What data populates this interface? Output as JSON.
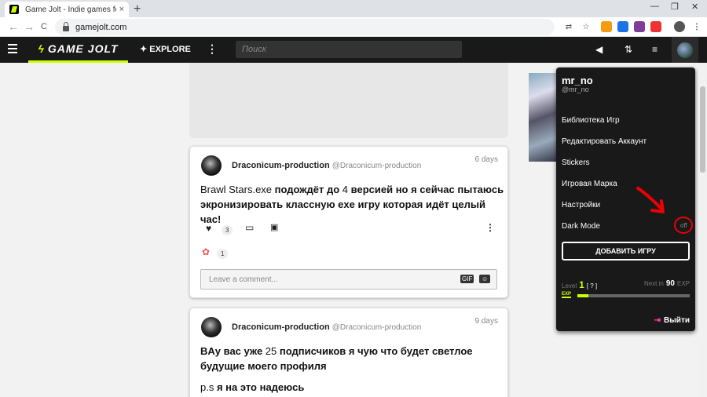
{
  "browser": {
    "tab_title": "Game Jolt - Indie games for the ...",
    "tab_close": "×",
    "new_tab": "+",
    "url": "gamejolt.com",
    "back": "←",
    "forward": "→",
    "reload": "C",
    "window_controls": [
      "—",
      "❐",
      "✕"
    ]
  },
  "navbar": {
    "logo": "GAME JOLT",
    "explore": "EXPLORE",
    "search_placeholder": "Поиск"
  },
  "posts": [
    {
      "author": "Draconicum-production",
      "handle": "@Draconicum-production",
      "time": "6 days",
      "body_line1_a": "Brawl Stars.exe",
      "body_line1_b": " подождёт до ",
      "body_line1_c": "4",
      "body_line1_d": " версией но я сейчас пытаюсь",
      "body_line2": "экронизировать классную exe игру которая идёт целый час!",
      "likes": "3",
      "reaction_count": "1",
      "comment_placeholder": "Leave a comment...",
      "gif_label": "GIF"
    },
    {
      "author": "Draconicum-production",
      "handle": "@Draconicum-production",
      "time": "9 days",
      "body_line1_a": "B",
      "body_line1_b": "Ау вас уже ",
      "body_line1_c": "25",
      "body_line1_d": " подписчиков я чую что будет светлое",
      "body_line2": "будущие моего профиля",
      "body_line3_a": "p.s",
      "body_line3_b": " я на это надеюсь"
    }
  ],
  "dropdown": {
    "username": "mr_no",
    "handle": "@mr_no",
    "items": [
      "Библиотека Игр",
      "Редактировать Аккаунт",
      "Stickers",
      "Игровая Марка",
      "Настройки",
      "Dark Mode"
    ],
    "dark_mode_state": "off",
    "add_game": "ДОБАВИТЬ ИГРУ",
    "level_label": "Level",
    "level": "1",
    "level_help": "[ ? ]",
    "next_label": "Next in",
    "next_value": "90",
    "next_unit": "EXP",
    "exp_label": "EXP",
    "exp_progress": 0.1,
    "logout": "Выйти"
  },
  "colors": {
    "accent": "#ccff00",
    "navbar_bg": "#191919",
    "logout_icon": "#ff3fac",
    "annotation_red": "#e00000"
  }
}
